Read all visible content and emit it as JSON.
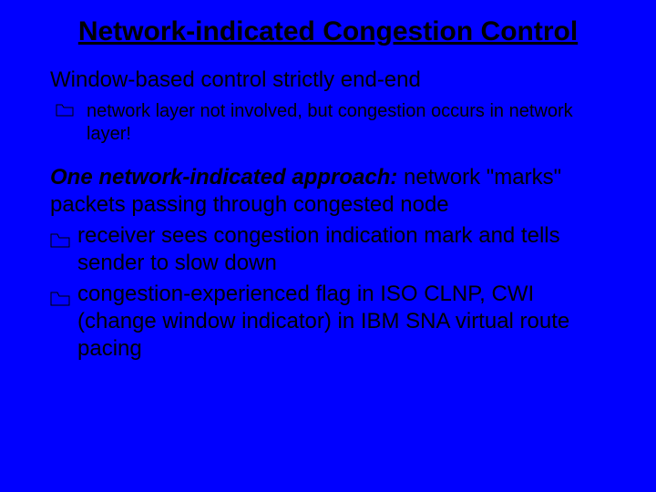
{
  "slide": {
    "title": "Network-indicated Congestion Control",
    "subhead1": "Window-based control strictly end-end",
    "bullet1": "network layer not involved, but congestion occurs in network layer!",
    "approach": {
      "lead": "One network-indicated approach:",
      "lead_cont": " network \"marks\" packets passing through congested node",
      "b1": "receiver sees congestion indication mark and tells sender to slow down",
      "b2": "congestion-experienced flag in ISO CLNP, CWI (change window indicator) in IBM SNA virtual route pacing"
    }
  }
}
